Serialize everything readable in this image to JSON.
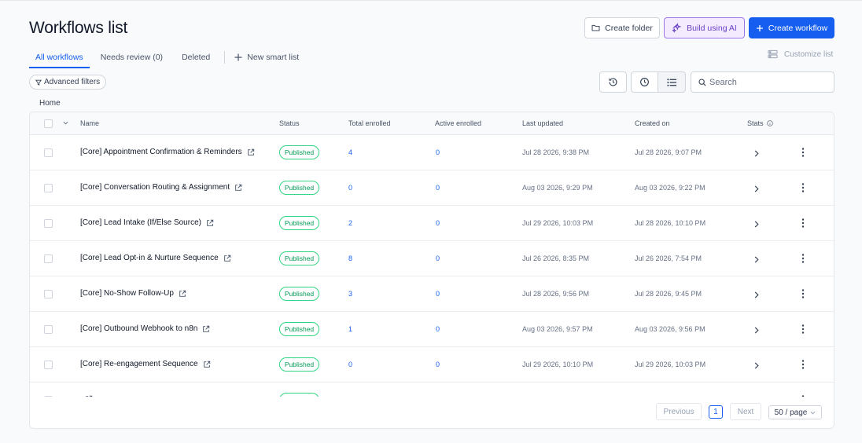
{
  "header": {
    "title": "Workflows list",
    "create_folder": "Create folder",
    "build_ai": "Build using AI",
    "create_workflow": "Create workflow"
  },
  "tabs": [
    {
      "label": "All workflows",
      "active": true
    },
    {
      "label": "Needs review (0)",
      "active": false
    },
    {
      "label": "Deleted",
      "active": false
    }
  ],
  "new_smart_list": "New smart list",
  "customize_list": "Customize list",
  "advanced_filters": "Advanced filters",
  "search": {
    "placeholder": "Search",
    "value": ""
  },
  "breadcrumb": "Home",
  "columns": {
    "name": "Name",
    "status": "Status",
    "total_enrolled": "Total enrolled",
    "active_enrolled": "Active enrolled",
    "last_updated": "Last updated",
    "created_on": "Created on",
    "stats": "Stats"
  },
  "rows": [
    {
      "name": "[Core] Appointment Confirmation & Reminders",
      "status": "Published",
      "total": "4",
      "active": "0",
      "updated": "Jul 28 2026, 9:38 PM",
      "created": "Jul 28 2026, 9:07 PM"
    },
    {
      "name": "[Core] Conversation Routing & Assignment",
      "status": "Published",
      "total": "0",
      "active": "0",
      "updated": "Aug 03 2026, 9:29 PM",
      "created": "Aug 03 2026, 9:22 PM"
    },
    {
      "name": "[Core] Lead Intake (If/Else Source)",
      "status": "Published",
      "total": "2",
      "active": "0",
      "updated": "Jul 29 2026, 10:03 PM",
      "created": "Jul 28 2026, 10:10 PM"
    },
    {
      "name": "[Core] Lead Opt‑in & Nurture Sequence",
      "status": "Published",
      "total": "8",
      "active": "0",
      "updated": "Jul 26 2026, 8:35 PM",
      "created": "Jul 26 2026, 7:54 PM"
    },
    {
      "name": "[Core] No‑Show Follow‑Up",
      "status": "Published",
      "total": "3",
      "active": "0",
      "updated": "Jul 28 2026, 9:56 PM",
      "created": "Jul 28 2026, 9:45 PM"
    },
    {
      "name": "[Core] Outbound Webhook to n8n",
      "status": "Published",
      "total": "1",
      "active": "0",
      "updated": "Aug 03 2026, 9:57 PM",
      "created": "Aug 03 2026, 9:56 PM"
    },
    {
      "name": "[Core] Re‑engagement Sequence",
      "status": "Published",
      "total": "0",
      "active": "0",
      "updated": "Jul 29 2026, 10:10 PM",
      "created": "Jul 29 2026, 10:03 PM"
    },
    {
      "name": "",
      "status": "",
      "total": "",
      "active": "",
      "updated": "",
      "created": ""
    }
  ],
  "pagination": {
    "previous": "Previous",
    "page": "1",
    "next": "Next",
    "page_size": "50 / page"
  }
}
